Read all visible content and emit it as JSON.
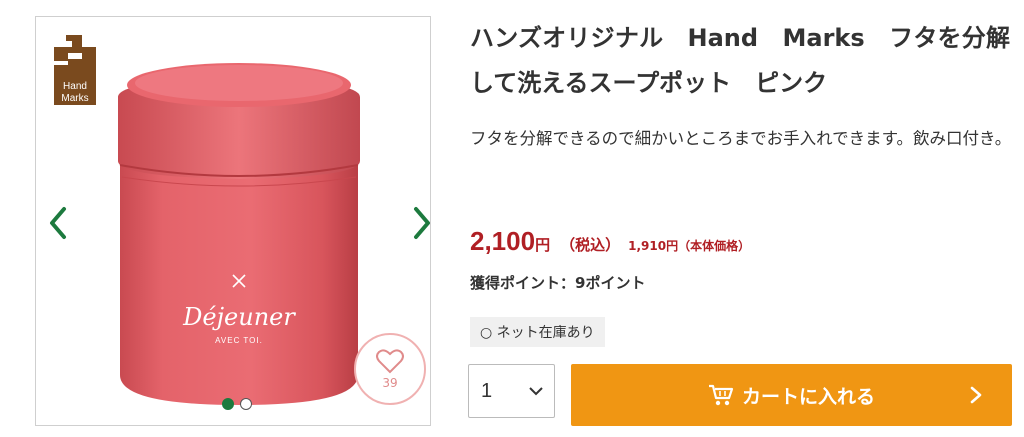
{
  "brand_logo": {
    "line1": "Hand",
    "line2": "Marks",
    "color": "#7a4a1e"
  },
  "gallery": {
    "favorite_count": "39",
    "arrow_color": "#1d7a3e",
    "product_print": {
      "main": "Déjeuner",
      "sub": "AVEC TOI."
    },
    "dots_count": 2,
    "active_dot": 0
  },
  "product": {
    "title": "ハンズオリジナル　Hand　Marks　フタを分解して洗えるスープポット　ピンク",
    "description": "フタを分解できるので細かいところまでお手入れできます。飲み口付き。",
    "price": {
      "amount": "2,100",
      "yen": "円",
      "tax_label": "（税込）",
      "base": "1,910円（本体価格）"
    },
    "points": "獲得ポイント：9ポイント",
    "stock": "○ ネット在庫あり"
  },
  "purchase": {
    "quantity": "1",
    "cart_label": "カートに入れる"
  },
  "colors": {
    "price": "#b01f24",
    "cart_button": "#f09613",
    "accent_green": "#1d7a3e",
    "product_pink": "#e4636a"
  }
}
